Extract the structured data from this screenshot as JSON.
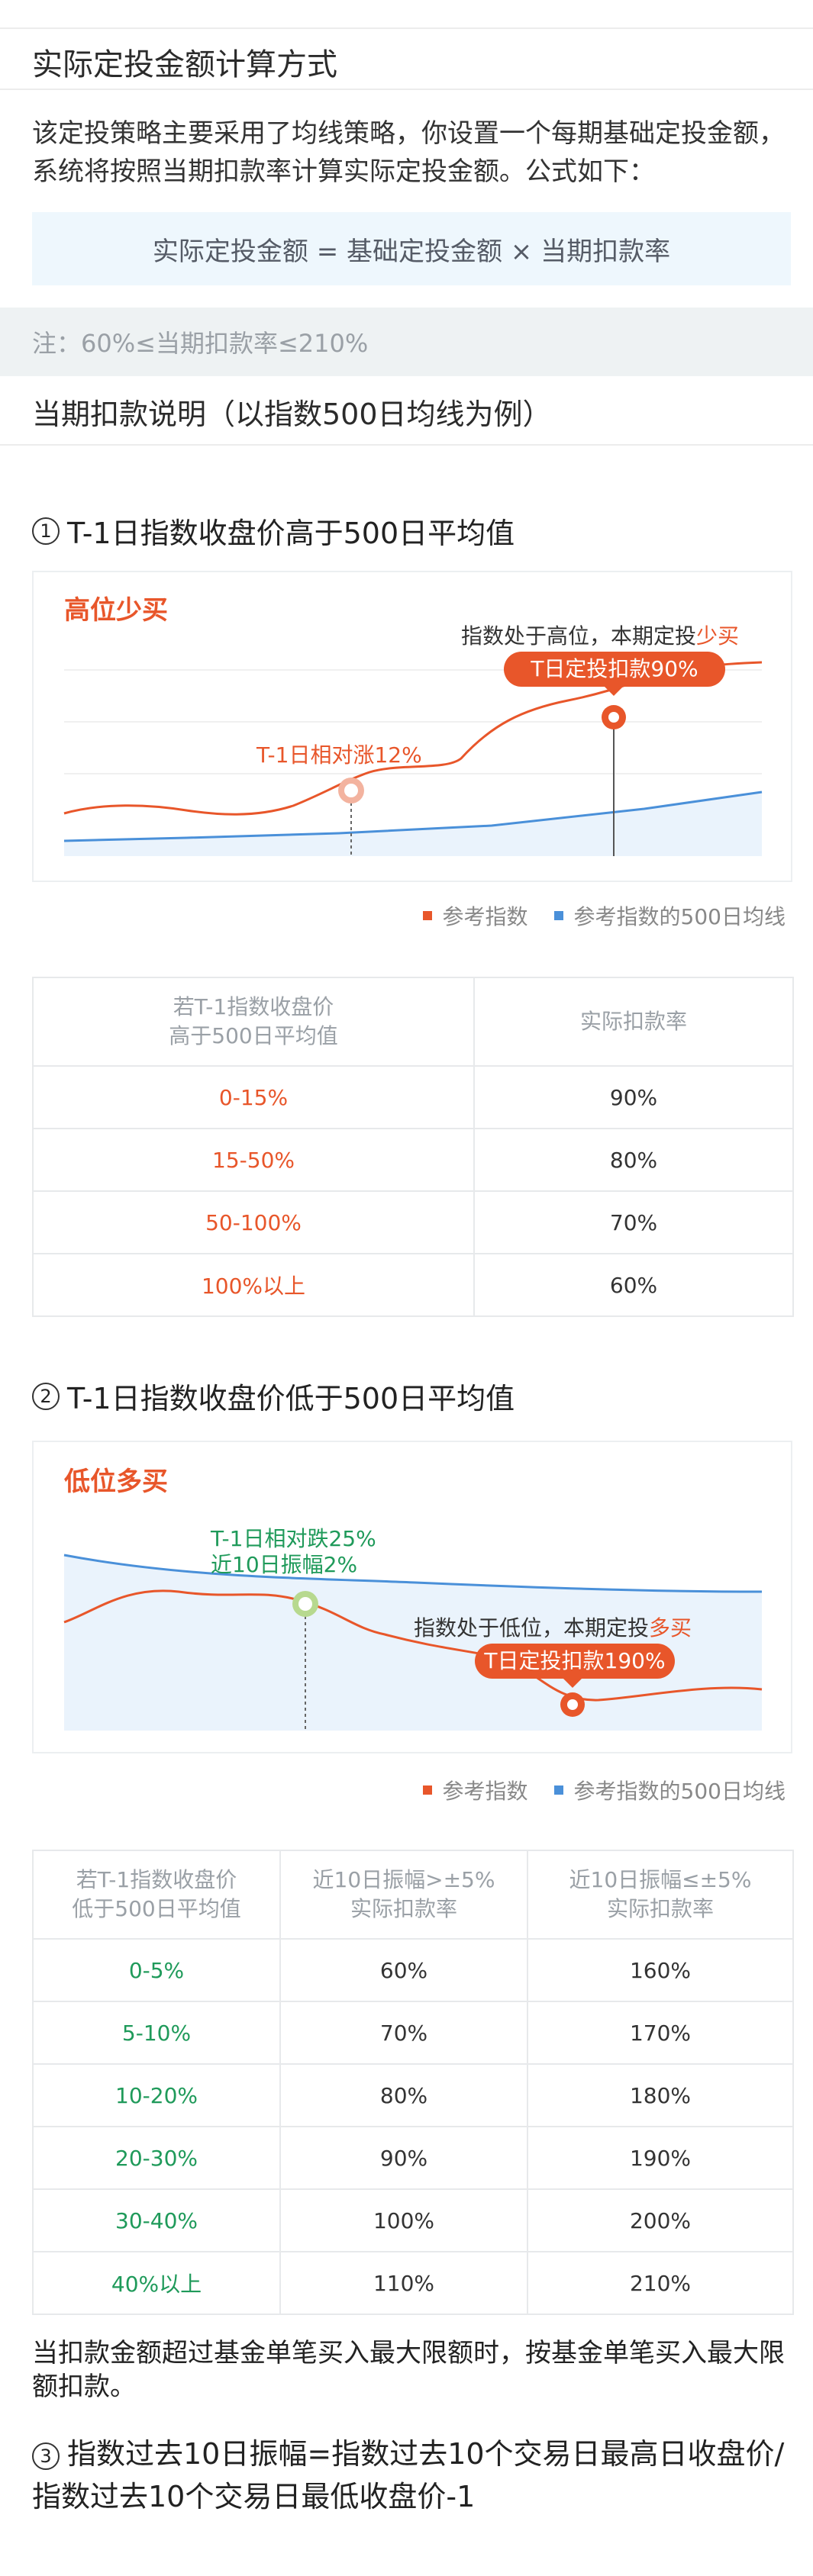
{
  "section_title": "实际定投金额计算方式",
  "intro": "该定投策略主要采用了均线策略，你设置一个每期基础定投金额，系统将按照当期扣款率计算实际定投金额。公式如下：",
  "formula": "实际定投金额 = 基础定投金额 × 当期扣款率",
  "note": "注：60%≤当期扣款率≤210%",
  "explain_title": "当期扣款说明（以指数500日均线为例）",
  "case1": {
    "num": "1",
    "title": "T-1日指数收盘价高于500日平均值",
    "chart_label": "高位少买",
    "annotation_prefix": "指数处于高位，本期定投",
    "annotation_highlight": "少买",
    "bubble": "T日定投扣款90%",
    "point_label": "T-1日相对涨12%"
  },
  "case2": {
    "num": "2",
    "title": "T-1日指数收盘价低于500日平均值",
    "chart_label": "低位多买",
    "point_label_line1": "T-1日相对跌25%",
    "point_label_line2": "近10日振幅2%",
    "annotation_prefix": "指数处于低位，本期定投",
    "annotation_highlight": "多买",
    "bubble": "T日定投扣款190%"
  },
  "legend": {
    "series1": "参考指数",
    "series2": "参考指数的500日均线",
    "color1": "#e8562a",
    "color2": "#4a90d9"
  },
  "table1": {
    "header_col1_line1": "若T-1指数收盘价",
    "header_col1_line2": "高于500日平均值",
    "header_col2": "实际扣款率",
    "rows": [
      [
        "0-15%",
        "90%"
      ],
      [
        "15-50%",
        "80%"
      ],
      [
        "50-100%",
        "70%"
      ],
      [
        "100%以上",
        "60%"
      ]
    ]
  },
  "table2": {
    "header_col1_line1": "若T-1指数收盘价",
    "header_col1_line2": "低于500日平均值",
    "header_col2_line1": "近10日振幅>±5%",
    "header_col2_line2": "实际扣款率",
    "header_col3_line1": "近10日振幅≤±5%",
    "header_col3_line2": "实际扣款率",
    "rows": [
      [
        "0-5%",
        "60%",
        "160%"
      ],
      [
        "5-10%",
        "70%",
        "170%"
      ],
      [
        "10-20%",
        "80%",
        "180%"
      ],
      [
        "20-30%",
        "90%",
        "190%"
      ],
      [
        "30-40%",
        "100%",
        "200%"
      ],
      [
        "40%以上",
        "110%",
        "210%"
      ]
    ]
  },
  "footnote": "当扣款金额超过基金单笔买入最大限额时，按基金单笔买入最大限额扣款。",
  "case3": {
    "num": "3",
    "text": "指数过去10日振幅=指数过去10个交易日最高日收盘价/指数过去10个交易日最低收盘价-1"
  }
}
